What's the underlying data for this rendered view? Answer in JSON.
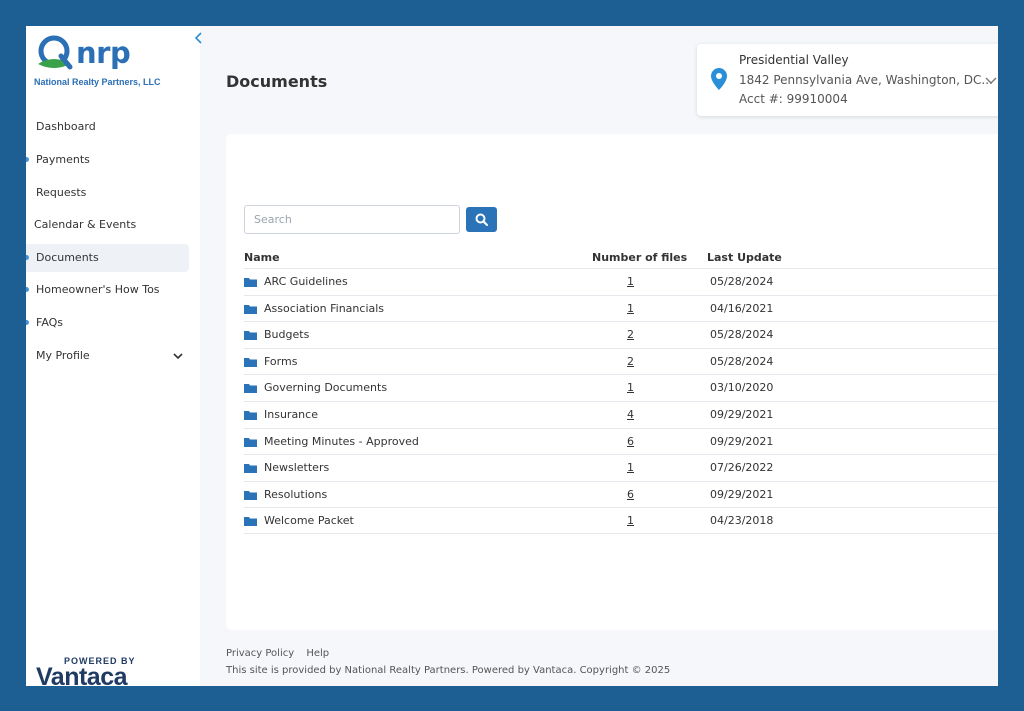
{
  "sidebar": {
    "logo_text": "nrp",
    "company_name": "National Realty Partners, LLC",
    "collapse_icon": "chevron-left-icon",
    "items": [
      {
        "label": "Dashboard"
      },
      {
        "label": "Payments"
      },
      {
        "label": "Requests"
      },
      {
        "label": "Calendar & Events"
      },
      {
        "label": "Documents"
      },
      {
        "label": "Homeowner's How Tos"
      },
      {
        "label": "FAQs"
      },
      {
        "label": "My Profile"
      }
    ],
    "powered_by": "POWERED BY",
    "powered_brand": "Vantaca"
  },
  "header": {
    "title": "Documents"
  },
  "property": {
    "name": "Presidential Valley",
    "address": "1842 Pennsylvania Ave, Washington, DC...",
    "account": "Acct #: 99910004"
  },
  "search": {
    "placeholder": "Search"
  },
  "table": {
    "columns": {
      "name": "Name",
      "files": "Number of files",
      "updated": "Last Update"
    },
    "rows": [
      {
        "name": "ARC Guidelines",
        "files": "1",
        "updated": "05/28/2024"
      },
      {
        "name": "Association Financials",
        "files": "1",
        "updated": "04/16/2021"
      },
      {
        "name": "Budgets",
        "files": "2",
        "updated": "05/28/2024"
      },
      {
        "name": "Forms",
        "files": "2",
        "updated": "05/28/2024"
      },
      {
        "name": "Governing Documents",
        "files": "1",
        "updated": "03/10/2020"
      },
      {
        "name": "Insurance",
        "files": "4",
        "updated": "09/29/2021"
      },
      {
        "name": "Meeting Minutes - Approved",
        "files": "6",
        "updated": "09/29/2021"
      },
      {
        "name": "Newsletters",
        "files": "1",
        "updated": "07/26/2022"
      },
      {
        "name": "Resolutions",
        "files": "6",
        "updated": "09/29/2021"
      },
      {
        "name": "Welcome Packet",
        "files": "1",
        "updated": "04/23/2018"
      }
    ]
  },
  "footer": {
    "privacy": "Privacy Policy",
    "help": "Help",
    "copyright": "This site is provided by National Realty Partners. Powered by Vantaca. Copyright © 2025"
  },
  "colors": {
    "frame": "#1d5f93",
    "accent": "#2b73b9",
    "logo_green": "#3aa14b"
  }
}
